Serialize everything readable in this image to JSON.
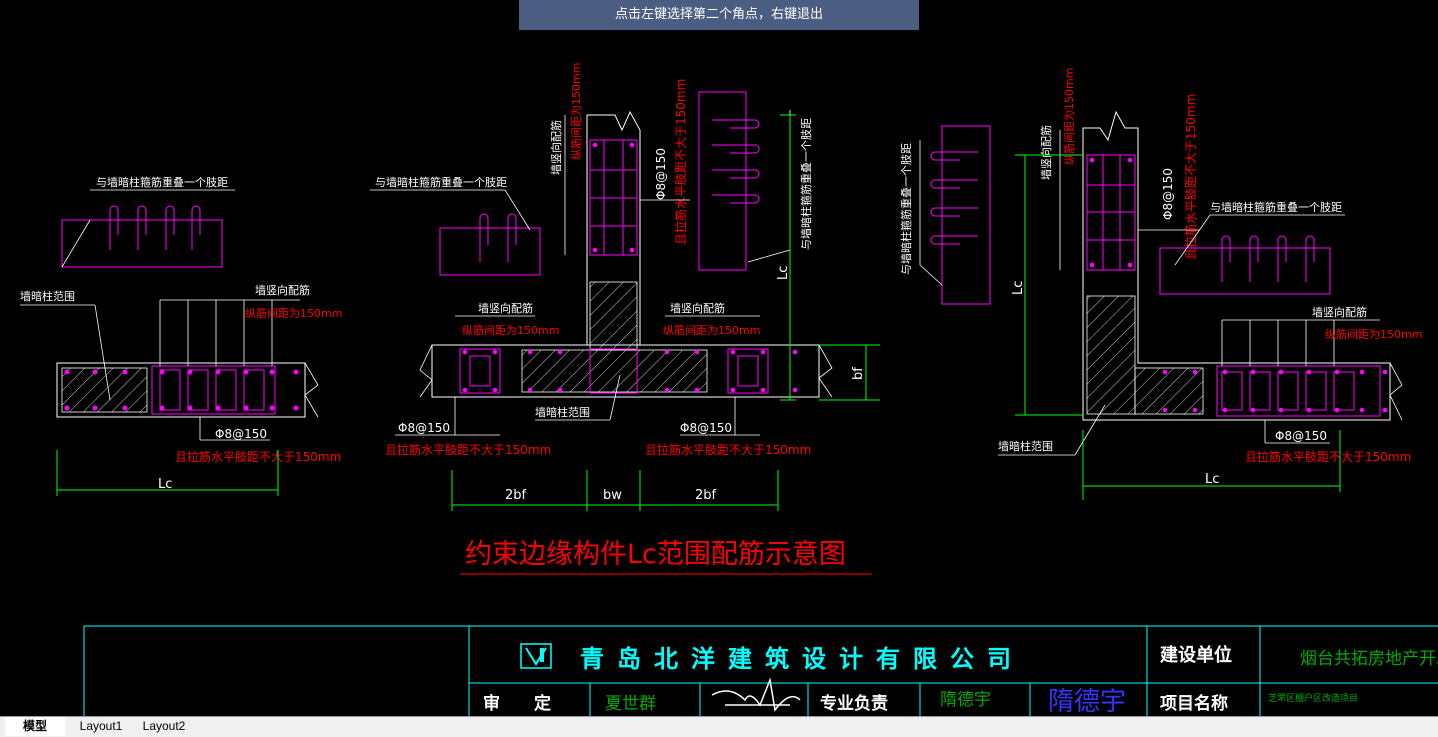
{
  "prompt": {
    "text": "点击左键选择第二个角点，右键退出"
  },
  "tabs": [
    {
      "label": "模型",
      "active": true
    },
    {
      "label": "Layout1"
    },
    {
      "label": "Layout2"
    }
  ],
  "colors": {
    "background": "#000000",
    "magenta": "#ff00ff",
    "red": "#ff0000",
    "green": "#00ff00",
    "white": "#ffffff",
    "cyan": "#00ffff",
    "blue": "#0000ff",
    "prompt_bg": "#4b5d80"
  },
  "drawing": {
    "title": "约束边缘构件Lc范围配筋示意图",
    "left": {
      "overlap_note": "与墙暗柱箍筋重叠一个肢距",
      "column_range": "墙暗柱范围",
      "vertical_bars": "墙竖向配筋",
      "spacing_note": "纵筋间距为150mm",
      "stirrup": "Φ8@150",
      "tie_note": "且拉筋水平肢距不大于150mm",
      "dim": "Lc"
    },
    "middle": {
      "overlap_note": "与墙暗柱箍筋重叠一个肢距",
      "overlap_note_vertical": "与墙暗柱箍筋重叠一个肢距",
      "vertical_bars_top": "墙竖向配筋",
      "spacing_note_top": "纵筋间距为150mm",
      "stirrup_top": "Φ8@150",
      "tie_note_top": "且拉筋水平肢距不大于150mm",
      "vertical_bars_left": "墙竖向配筋",
      "spacing_note_left": "纵筋间距为150mm",
      "vertical_bars_right": "墙竖向配筋",
      "spacing_note_right": "纵筋间距为150mm",
      "column_range": "墙暗柱范围",
      "stirrup_left": "Φ8@150",
      "tie_note_left": "且拉筋水平肢距不大于150mm",
      "stirrup_right": "Φ8@150",
      "tie_note_right": "且拉筋水平肢距不大于150mm",
      "dim_lc": "Lc",
      "dim_bf": "bf",
      "dim_2bf_left": "2bf",
      "dim_bw": "bw",
      "dim_2bf_right": "2bf"
    },
    "right": {
      "overlap_note_vertical": "与墙暗柱箍筋重叠一个肢距",
      "overlap_note": "与墙暗柱箍筋重叠一个肢距",
      "vertical_bars_top": "墙竖向配筋",
      "spacing_note_top": "纵筋间距为150mm",
      "stirrup_top": "Φ8@150",
      "tie_note_top": "且拉筋水平肢距不大于150mm",
      "vertical_bars_right": "墙竖向配筋",
      "spacing_note_right": "纵筋间距为150mm",
      "column_range": "墙暗柱范围",
      "stirrup": "Φ8@150",
      "tie_note": "且拉筋水平肢距不大于150mm",
      "dim_lc_vertical": "Lc",
      "dim_lc": "Lc"
    }
  },
  "title_block": {
    "company": "青岛北洋建筑设计有限公司",
    "build_unit_label": "建设单位",
    "build_unit_value": "烟台共拓房地产开发有",
    "review_label": "审　　定",
    "review_name": "夏世群",
    "discipline_label": "专业负责",
    "discipline_name": "隋德宇",
    "signature": "隋德宇",
    "project_label": "项目名称",
    "project_value": "芝罘区棚户区改造项目"
  }
}
